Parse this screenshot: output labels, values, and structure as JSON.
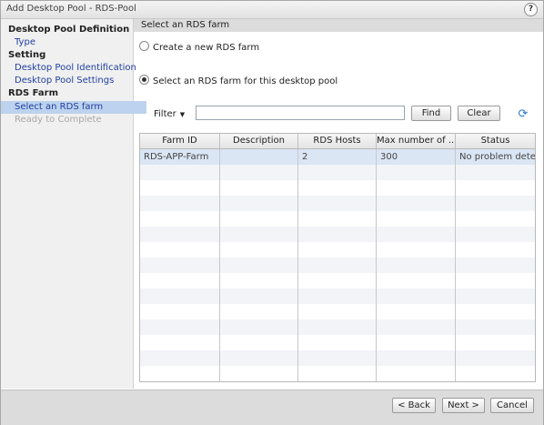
{
  "window": {
    "title": "Add Desktop Pool - RDS-Pool",
    "help_label": "?"
  },
  "sidebar": {
    "items": [
      {
        "label": "Desktop Pool Definition",
        "kind": "section"
      },
      {
        "label": "Type",
        "kind": "item"
      },
      {
        "label": "Setting",
        "kind": "section"
      },
      {
        "label": "Desktop Pool Identification",
        "kind": "item"
      },
      {
        "label": "Desktop Pool Settings",
        "kind": "item"
      },
      {
        "label": "RDS Farm",
        "kind": "section"
      },
      {
        "label": "Select an RDS farm",
        "kind": "item",
        "selected": true
      },
      {
        "label": "Ready to Complete",
        "kind": "item",
        "disabled": true
      }
    ]
  },
  "main": {
    "header": "Select an RDS farm",
    "option_create": "Create a new RDS farm",
    "option_select": "Select an RDS farm for this desktop pool",
    "selected_option": "option_select"
  },
  "filter": {
    "label": "Filter",
    "input_value": "",
    "find_label": "Find",
    "clear_label": "Clear"
  },
  "table": {
    "columns": [
      "Farm ID",
      "Description",
      "RDS Hosts",
      "Max number of ...",
      "Status"
    ],
    "rows": [
      [
        "RDS-APP-Farm",
        "",
        "2",
        "300",
        "No problem detect"
      ]
    ]
  },
  "footer": {
    "back_label": "< Back",
    "next_label": "Next >",
    "cancel_label": "Cancel"
  },
  "colors": {
    "selection": "#bcd2ee",
    "link": "#1f3fa0",
    "accent": "#2a78c8"
  }
}
